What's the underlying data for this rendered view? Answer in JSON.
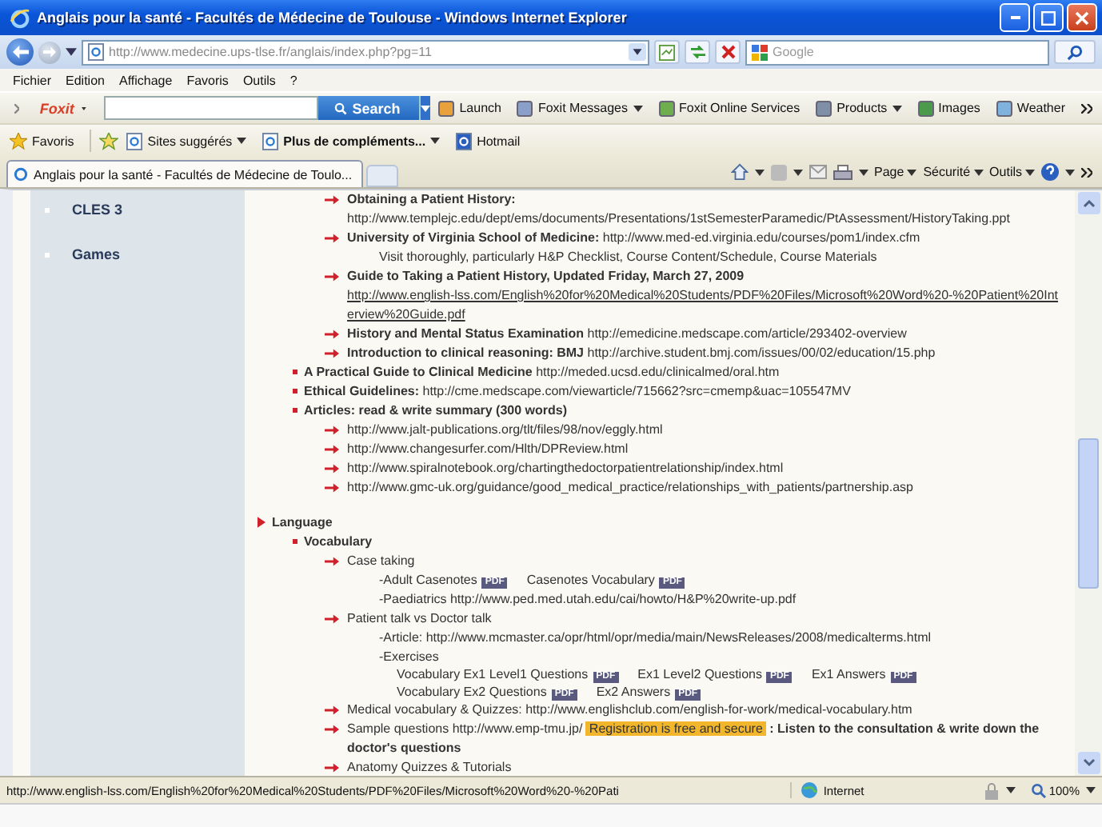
{
  "window": {
    "title": "Anglais pour la santé - Facultés de Médecine de Toulouse - Windows Internet Explorer"
  },
  "address_bar": {
    "value": "http://www.medecine.ups-tlse.fr/anglais/index.php?pg=11"
  },
  "search": {
    "placeholder": "Google"
  },
  "menu": [
    "Fichier",
    "Edition",
    "Affichage",
    "Favoris",
    "Outils",
    "?"
  ],
  "foxit_toolbar": {
    "logo": "Foxit",
    "search_button": "Search",
    "items": [
      {
        "label": "Launch",
        "dropdown": false
      },
      {
        "label": "Foxit Messages",
        "dropdown": true
      },
      {
        "label": "Foxit Online Services",
        "dropdown": false
      },
      {
        "label": "Products",
        "dropdown": true
      },
      {
        "label": "Images",
        "dropdown": false
      },
      {
        "label": "Weather",
        "dropdown": false
      }
    ]
  },
  "favorites_bar": {
    "favorites": "Favoris",
    "items": [
      {
        "label": "Sites suggérés",
        "dropdown": true,
        "bold": false
      },
      {
        "label": "Plus de compléments...",
        "dropdown": true,
        "bold": true
      },
      {
        "label": "Hotmail",
        "dropdown": false,
        "bold": false
      }
    ]
  },
  "tabs": [
    {
      "label": "Anglais pour la santé - Facultés de Médecine de Toulo...",
      "selected": true
    }
  ],
  "command_bar": [
    {
      "label": "Page"
    },
    {
      "label": "Sécurité"
    },
    {
      "label": "Outils"
    }
  ],
  "sidebar": {
    "items": [
      "CLES 3",
      "Games"
    ]
  },
  "content": [
    {
      "kind": "arrow",
      "parts": [
        {
          "kind": "bold",
          "text": "Obtaining a Patient History:"
        },
        {
          "kind": "text",
          "text": "http://www.templejc.edu/dept/ems/documents/Presentations/1stSemesterParamedic/PtAssessment/HistoryTaking.ppt"
        }
      ]
    },
    {
      "kind": "arrow",
      "parts": [
        {
          "kind": "text",
          "text": "**University of Virginia School of Medicine:** http://www.med-ed.virginia.edu/courses/pom1/index.cfm"
        }
      ],
      "children": [
        {
          "kind": "note",
          "parts": [
            {
              "kind": "text",
              "text": "Visit thoroughly, particularly H&P Checklist, Course Content/Schedule, Course Materials"
            }
          ]
        }
      ]
    },
    {
      "kind": "arrow",
      "parts": [
        {
          "kind": "bold",
          "text": "Guide to Taking a Patient History, Updated Friday, March 27, 2009"
        },
        {
          "kind": "link",
          "text": "http://www.english-lss.com/English%20for%20Medical%20Students/PDF%20Files/Microsoft%20Word%20-%20Patient%20Interview%20Guide.pdf"
        }
      ]
    },
    {
      "kind": "arrow",
      "parts": [
        {
          "kind": "text",
          "text": "**History and Mental Status Examination** http://emedicine.medscape.com/article/293402-overview"
        }
      ]
    },
    {
      "kind": "arrow",
      "parts": [
        {
          "kind": "text",
          "text": "**Introduction to clinical reasoning: BMJ** http://archive.student.bmj.com/issues/00/02/education/15.php"
        }
      ]
    },
    {
      "kind": "bullet",
      "parts": [
        {
          "kind": "text",
          "text": "**A Practical Guide to Clinical Medicine** http://meded.ucsd.edu/clinicalmed/oral.htm"
        }
      ]
    },
    {
      "kind": "bullet",
      "parts": [
        {
          "kind": "text",
          "text": "**Ethical Guidelines:** http://cme.medscape.com/viewarticle/715662?src=cmemp&uac=105547MV"
        }
      ]
    },
    {
      "kind": "bullet",
      "parts": [
        {
          "kind": "bold",
          "text": "Articles: read & write summary (300 words)"
        }
      ],
      "children": [
        {
          "kind": "arrow",
          "parts": [
            {
              "kind": "text",
              "text": "http://www.jalt-publications.org/tlt/files/98/nov/eggly.html"
            }
          ]
        },
        {
          "kind": "arrow",
          "parts": [
            {
              "kind": "text",
              "text": "http://www.changesurfer.com/Hlth/DPReview.html"
            }
          ]
        },
        {
          "kind": "arrow",
          "parts": [
            {
              "kind": "text",
              "text": "http://www.spiralnotebook.org/chartingthedoctorpatientrelationship/index.html"
            }
          ]
        },
        {
          "kind": "arrow",
          "parts": [
            {
              "kind": "text",
              "text": "http://www.gmc-uk.org/guidance/good_medical_practice/relationships_with_patients/partnership.asp"
            }
          ]
        }
      ]
    },
    {
      "kind": "section",
      "parts": [
        {
          "kind": "bold",
          "text": "Language"
        }
      ],
      "children": [
        {
          "kind": "bullet",
          "parts": [
            {
              "kind": "bold",
              "text": "Vocabulary"
            }
          ],
          "children": [
            {
              "kind": "arrow",
              "parts": [
                {
                  "kind": "text",
                  "text": "Case taking"
                }
              ],
              "children": [
                {
                  "kind": "note",
                  "parts": [
                    {
                      "kind": "text",
                      "text": "-Adult Casenotes"
                    },
                    {
                      "kind": "badge",
                      "text": "PDF"
                    },
                    {
                      "kind": "text",
                      "text": "Casenotes Vocabulary"
                    },
                    {
                      "kind": "badge",
                      "text": "PDF"
                    }
                  ]
                },
                {
                  "kind": "note",
                  "parts": [
                    {
                      "kind": "text",
                      "text": "-Paediatrics http://www.ped.med.utah.edu/cai/howto/H&P%20write-up.pdf"
                    }
                  ]
                }
              ]
            },
            {
              "kind": "arrow",
              "parts": [
                {
                  "kind": "text",
                  "text": "Patient talk vs Doctor talk"
                }
              ],
              "children": [
                {
                  "kind": "note",
                  "parts": [
                    {
                      "kind": "text",
                      "text": "-Article: http://www.mcmaster.ca/opr/html/opr/media/main/NewsReleases/2008/medicalterms.html"
                    }
                  ]
                },
                {
                  "kind": "note",
                  "parts": [
                    {
                      "kind": "text",
                      "text": "-Exercises"
                    }
                  ],
                  "children": [
                    {
                      "kind": "subnote",
                      "parts": [
                        {
                          "kind": "text",
                          "text": "Vocabulary Ex1 Level1 Questions"
                        },
                        {
                          "kind": "badge",
                          "text": "PDF"
                        },
                        {
                          "kind": "text",
                          "text": "Ex1 Level2 Questions"
                        },
                        {
                          "kind": "badge",
                          "text": "PDF"
                        },
                        {
                          "kind": "text",
                          "text": "Ex1 Answers"
                        },
                        {
                          "kind": "badge",
                          "text": "PDF"
                        }
                      ]
                    },
                    {
                      "kind": "subnote",
                      "parts": [
                        {
                          "kind": "text",
                          "text": "Vocabulary Ex2 Questions"
                        },
                        {
                          "kind": "badge",
                          "text": "PDF"
                        },
                        {
                          "kind": "text",
                          "text": "Ex2 Answers"
                        },
                        {
                          "kind": "badge",
                          "text": "PDF"
                        }
                      ]
                    }
                  ]
                }
              ]
            },
            {
              "kind": "arrow",
              "parts": [
                {
                  "kind": "text",
                  "text": "Medical vocabulary & Quizzes: http://www.englishclub.com/english-for-work/medical-vocabulary.htm"
                }
              ]
            },
            {
              "kind": "arrow",
              "parts": [
                {
                  "kind": "text",
                  "text": "Sample questions http://www.emp-tmu.jp/"
                },
                {
                  "kind": "highlight",
                  "text": "Registration is free and secure"
                },
                {
                  "kind": "bold",
                  "text": ": Listen to the consultation & write down the doctor's questions"
                }
              ]
            },
            {
              "kind": "arrow",
              "parts": [
                {
                  "kind": "text",
                  "text": "Anatomy Quizzes & Tutorials"
                }
              ]
            }
          ]
        }
      ]
    }
  ],
  "status_bar": {
    "text": "http://www.english-lss.com/English%20for%20Medical%20Students/PDF%20Files/Microsoft%20Word%20-%20Pati",
    "zone": "Internet",
    "zoom": "100%"
  }
}
